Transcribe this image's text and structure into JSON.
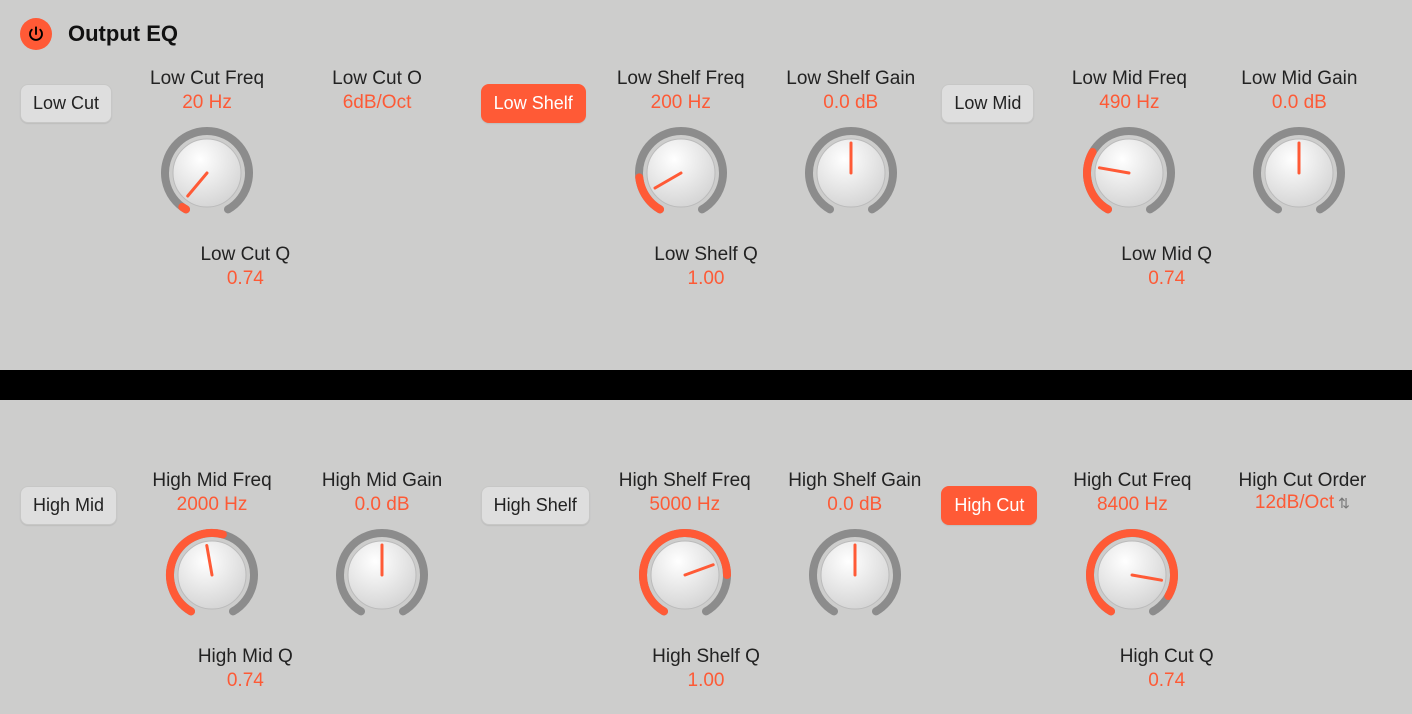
{
  "title": "Output EQ",
  "colors": {
    "accent": "#ff5a36",
    "bg": "#cdcdcc"
  },
  "row1": {
    "low_cut": {
      "btn": "Low Cut",
      "active": false,
      "freq": {
        "label": "Low Cut Freq",
        "value": "20 Hz",
        "angle": -140,
        "fill": 0.02
      },
      "order": {
        "label": "Low Cut O",
        "value": "6dB/Oct"
      },
      "q": {
        "label": "Low Cut Q",
        "value": "0.74"
      }
    },
    "low_shelf": {
      "btn": "Low Shelf",
      "active": true,
      "freq": {
        "label": "Low Shelf Freq",
        "value": "200 Hz",
        "angle": -120,
        "fill": 0.18
      },
      "gain": {
        "label": "Low Shelf Gain",
        "value": "0.0 dB",
        "angle": 0,
        "fill": 0.0
      },
      "q": {
        "label": "Low Shelf Q",
        "value": "1.00"
      }
    },
    "low_mid": {
      "btn": "Low Mid",
      "active": false,
      "freq": {
        "label": "Low Mid Freq",
        "value": "490 Hz",
        "angle": -80,
        "fill": 0.3
      },
      "gain": {
        "label": "Low Mid Gain",
        "value": "0.0 dB",
        "angle": 0,
        "fill": 0.0
      },
      "q": {
        "label": "Low Mid Q",
        "value": "0.74"
      }
    }
  },
  "row2": {
    "high_mid": {
      "btn": "High Mid",
      "active": false,
      "freq": {
        "label": "High Mid Freq",
        "value": "2000 Hz",
        "angle": -10,
        "fill": 0.55
      },
      "gain": {
        "label": "High Mid Gain",
        "value": "0.0 dB",
        "angle": 0,
        "fill": 0.0
      },
      "q": {
        "label": "High Mid Q",
        "value": "0.74"
      }
    },
    "high_shelf": {
      "btn": "High Shelf",
      "active": false,
      "freq": {
        "label": "High Shelf Freq",
        "value": "5000 Hz",
        "angle": 70,
        "fill": 0.8
      },
      "gain": {
        "label": "High Shelf Gain",
        "value": "0.0 dB",
        "angle": 0,
        "fill": 0.0
      },
      "q": {
        "label": "High Shelf Q",
        "value": "1.00"
      }
    },
    "high_cut": {
      "btn": "High Cut",
      "active": true,
      "freq": {
        "label": "High Cut Freq",
        "value": "8400 Hz",
        "angle": 100,
        "fill": 0.9
      },
      "order": {
        "label": "High Cut Order",
        "value": "12dB/Oct"
      },
      "q": {
        "label": "High Cut Q",
        "value": "0.74"
      }
    }
  }
}
